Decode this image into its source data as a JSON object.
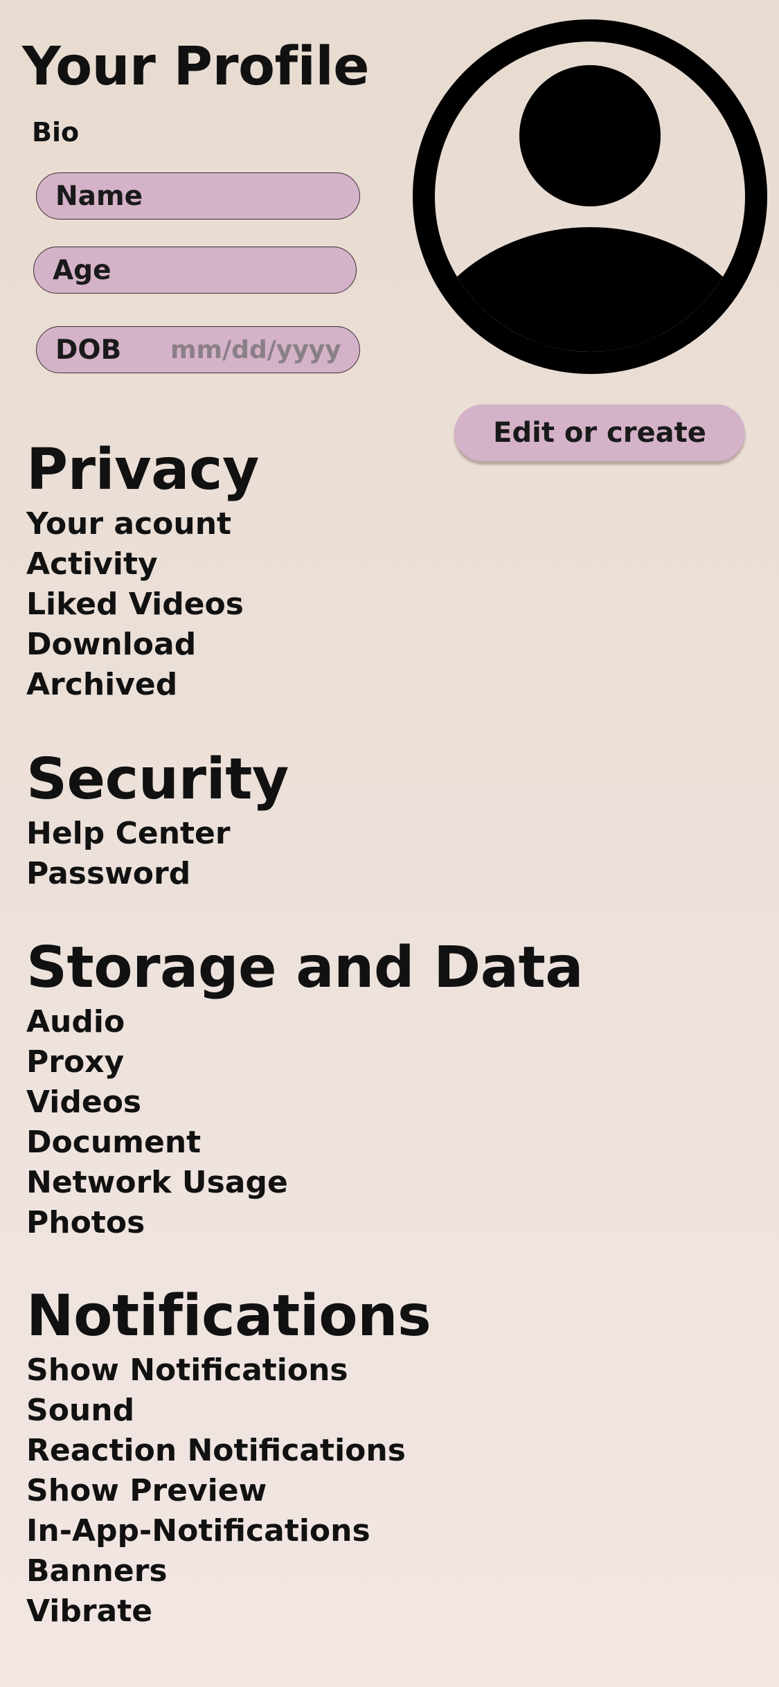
{
  "profile": {
    "title": "Your Profile",
    "bio_label": "Bio",
    "fields": {
      "name_label": "Name",
      "age_label": "Age",
      "dob_label": "DOB",
      "dob_placeholder": "mm/dd/yyyy"
    },
    "avatar_icon": "user-avatar-icon",
    "edit_button_label": "Edit or create"
  },
  "privacy": {
    "title": "Privacy",
    "items": [
      "Your acount",
      "Activity",
      "Liked Videos",
      "Download",
      "Archived"
    ]
  },
  "security": {
    "title": "Security",
    "items": [
      "Help Center",
      "Password"
    ]
  },
  "storage": {
    "title": "Storage and Data",
    "items": [
      "Audio",
      "Proxy",
      "Videos",
      "Document",
      "Network Usage",
      "Photos"
    ]
  },
  "notifications": {
    "title": "Notifications",
    "items": [
      "Show Notifications",
      "Sound",
      "Reaction Notifications",
      "Show Preview",
      "In-App-Notifications",
      "Banners",
      "Vibrate"
    ]
  },
  "colors": {
    "background_top": "#e8dbd0",
    "background_bottom": "#f2e6e3",
    "pill": "#d4b2c8",
    "text": "#111111"
  }
}
